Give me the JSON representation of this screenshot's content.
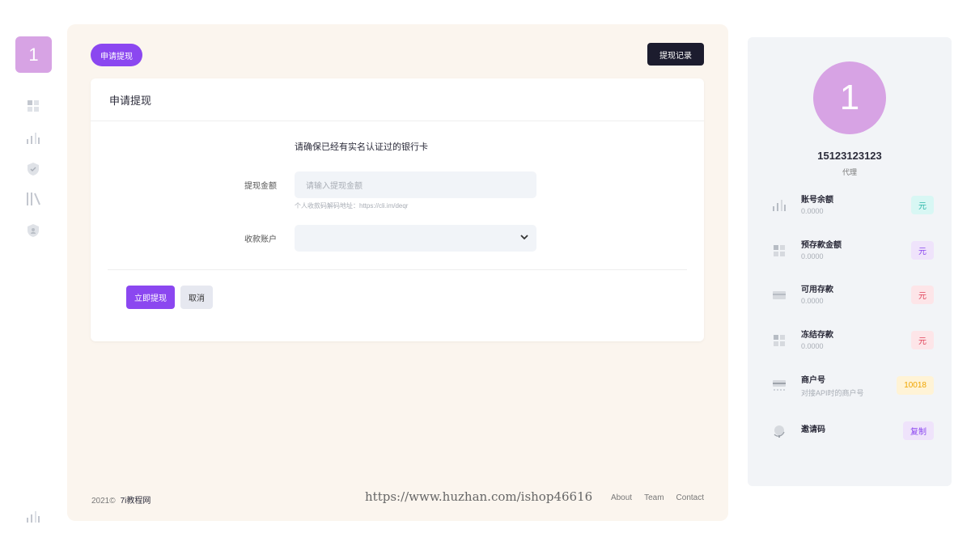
{
  "rail": {
    "logo_text": "1"
  },
  "header": {
    "tab_label": "申请提现",
    "records_button": "提现记录"
  },
  "form": {
    "card_title": "申请提现",
    "notice": "请确保已经有实名认证过的银行卡",
    "amount_label": "提现金额",
    "amount_placeholder": "请输入提现金额",
    "amount_hint": "个人收款码解码地址：https://cli.im/deqr",
    "account_label": "收款账户",
    "account_value": "",
    "submit_label": "立即提现",
    "cancel_label": "取消"
  },
  "footer": {
    "year": "2021©",
    "site": "7i教程网",
    "watermark": "https://www.huzhan.com/ishop46616",
    "links": [
      "About",
      "Team",
      "Contact"
    ]
  },
  "profile": {
    "avatar_text": "1",
    "username": "15123123123",
    "role": "代理"
  },
  "stats": [
    {
      "icon": "bar-chart-icon",
      "title": "账号余额",
      "value": "0.0000",
      "badge": "元",
      "badge_bg": "#d8f7f4",
      "badge_color": "#2bb7a8"
    },
    {
      "icon": "grid-icon",
      "title": "预存款金额",
      "value": "0.0000",
      "badge": "元",
      "badge_bg": "#efe3fb",
      "badge_color": "#8b47f0"
    },
    {
      "icon": "card-icon",
      "title": "可用存款",
      "value": "0.0000",
      "badge": "元",
      "badge_bg": "#fde5e8",
      "badge_color": "#e0445a"
    },
    {
      "icon": "grid-icon",
      "title": "冻结存款",
      "value": "0.0000",
      "badge": "元",
      "badge_bg": "#fde5e8",
      "badge_color": "#e0445a"
    },
    {
      "icon": "terminal-icon",
      "title": "商户号",
      "value": "对接API时的商户号",
      "badge": "10018",
      "badge_bg": "#fff3d6",
      "badge_color": "#f0a500"
    },
    {
      "icon": "globe-icon",
      "title": "邀请码",
      "value": "",
      "badge": "复制",
      "badge_bg": "#efe3fb",
      "badge_color": "#8b47f0"
    }
  ],
  "colors": {
    "accent": "#8b47f0",
    "brand_pink": "#d7a3e4",
    "dark": "#1c1c2e",
    "panel_bg": "#fbf5ee"
  }
}
